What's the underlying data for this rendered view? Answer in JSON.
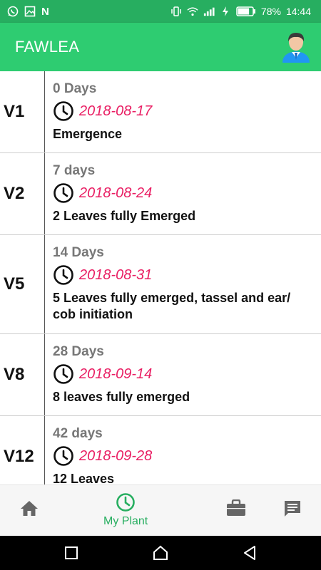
{
  "status_bar": {
    "carrier_letter": "N",
    "battery_percent": "78%",
    "time": "14:44",
    "battery_level": 0.78,
    "icons": [
      "whatsapp-icon",
      "image-icon",
      "vibrate-icon",
      "wifi-icon",
      "signal-icon",
      "battery-icon"
    ]
  },
  "app_bar": {
    "title": "FAWLEA",
    "avatar_icon": "user-avatar-icon"
  },
  "stages": [
    {
      "stage": "V1",
      "days": "0 Days",
      "date": "2018-08-17",
      "description": "Emergence"
    },
    {
      "stage": "V2",
      "days": "7 days",
      "date": "2018-08-24",
      "description": "2 Leaves fully Emerged"
    },
    {
      "stage": "V5",
      "days": "14 Days",
      "date": "2018-08-31",
      "description": "5 Leaves fully emerged, tassel and ear/ cob initiation"
    },
    {
      "stage": "V8",
      "days": "28 Days",
      "date": "2018-09-14",
      "description": "8 leaves fully emerged"
    },
    {
      "stage": "V12",
      "days": "42 days",
      "date": "2018-09-28",
      "description": "12 Leaves"
    }
  ],
  "bottom_nav": {
    "items": [
      {
        "icon": "home-icon",
        "label": ""
      },
      {
        "icon": "clock-icon",
        "label": "My Plant",
        "active": true
      },
      {
        "icon": "briefcase-icon",
        "label": ""
      },
      {
        "icon": "message-icon",
        "label": ""
      }
    ]
  },
  "colors": {
    "status_bar": "#27ae60",
    "app_bar": "#2ecc71",
    "accent": "#27ae60",
    "date_text": "#e91e63"
  }
}
